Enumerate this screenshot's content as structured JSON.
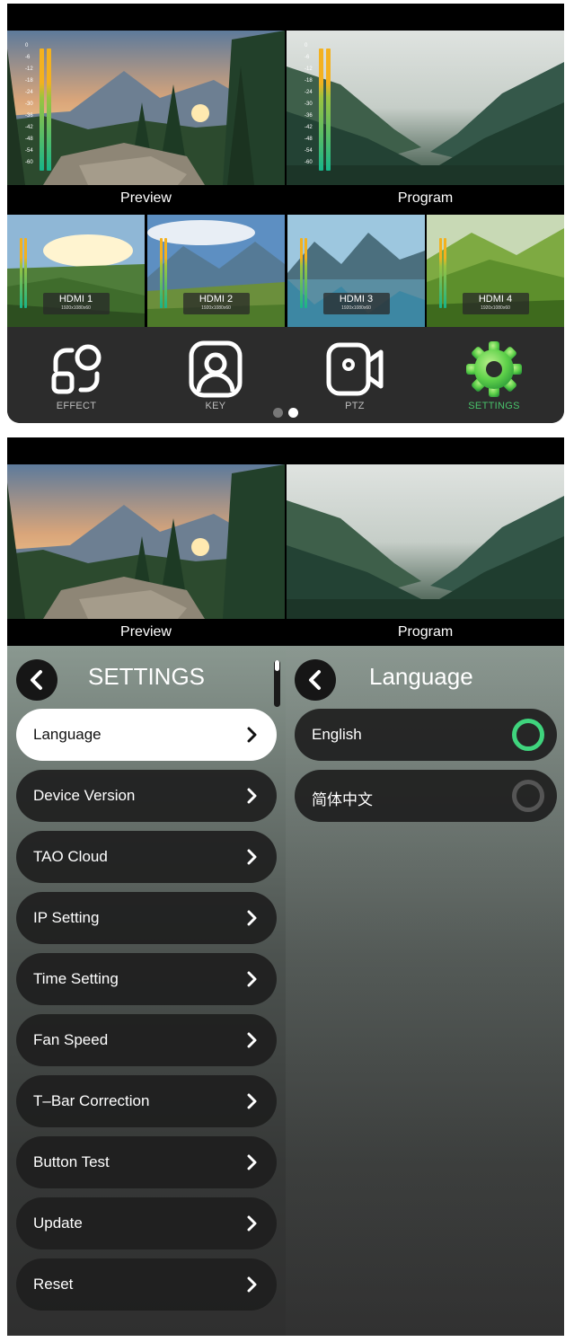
{
  "colors": {
    "accent_green": "#49c36b",
    "radio_selected": "#3fd47d",
    "radio_unselected": "#555555",
    "dock_bg": "#2c2c2c",
    "meter_top": "#f3b11f",
    "meter_bottom": "#17b58a"
  },
  "screen1": {
    "preview_label": "Preview",
    "program_label": "Program",
    "meter_scale": [
      "0",
      "-6",
      "-12",
      "-18",
      "-24",
      "-30",
      "-36",
      "-42",
      "-48",
      "-54",
      "-60"
    ],
    "inputs": [
      {
        "name": "HDMI 1",
        "resolution": "1920x1080x60"
      },
      {
        "name": "HDMI 2",
        "resolution": "1920x1080x60"
      },
      {
        "name": "HDMI 3",
        "resolution": "1920x1080x60"
      },
      {
        "name": "HDMI 4",
        "resolution": "1920x1080x60"
      }
    ],
    "dock": [
      {
        "label": "EFFECT",
        "icon": "effect-icon",
        "active": false
      },
      {
        "label": "KEY",
        "icon": "key-person-icon",
        "active": false
      },
      {
        "label": "PTZ",
        "icon": "ptz-camera-icon",
        "active": false
      },
      {
        "label": "SETTINGS",
        "icon": "gear-icon",
        "active": true
      }
    ],
    "page_dots": {
      "count": 2,
      "current": 2
    }
  },
  "screen2": {
    "preview_label": "Preview",
    "program_label": "Program",
    "settings": {
      "title": "SETTINGS",
      "back_icon": "chevron-left-icon",
      "items": [
        {
          "label": "Language",
          "selected": true
        },
        {
          "label": "Device Version",
          "selected": false
        },
        {
          "label": "TAO Cloud",
          "selected": false
        },
        {
          "label": "IP Setting",
          "selected": false
        },
        {
          "label": "Time Setting",
          "selected": false
        },
        {
          "label": "Fan Speed",
          "selected": false
        },
        {
          "label": "T–Bar Correction",
          "selected": false
        },
        {
          "label": "Button Test",
          "selected": false
        },
        {
          "label": "Update",
          "selected": false
        },
        {
          "label": "Reset",
          "selected": false
        }
      ]
    },
    "language": {
      "title": "Language",
      "options": [
        {
          "label": "English",
          "selected": true
        },
        {
          "label": "简体中文",
          "selected": false
        }
      ]
    }
  }
}
